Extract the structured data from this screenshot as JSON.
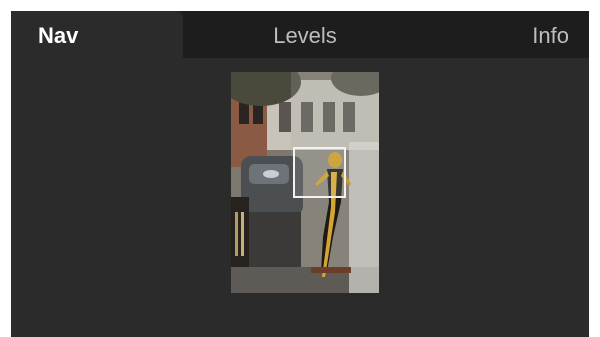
{
  "tabs": [
    {
      "label": "Nav",
      "active": true
    },
    {
      "label": "Levels",
      "active": false
    },
    {
      "label": "Info",
      "active": false
    }
  ],
  "colors": {
    "panel_bg": "#2b2b2b",
    "tabbar_bg": "#1d1d1d",
    "active_tab_text": "#ffffff",
    "inactive_tab_text": "#bdbdbd",
    "viewport_border": "#f2f2f2"
  }
}
